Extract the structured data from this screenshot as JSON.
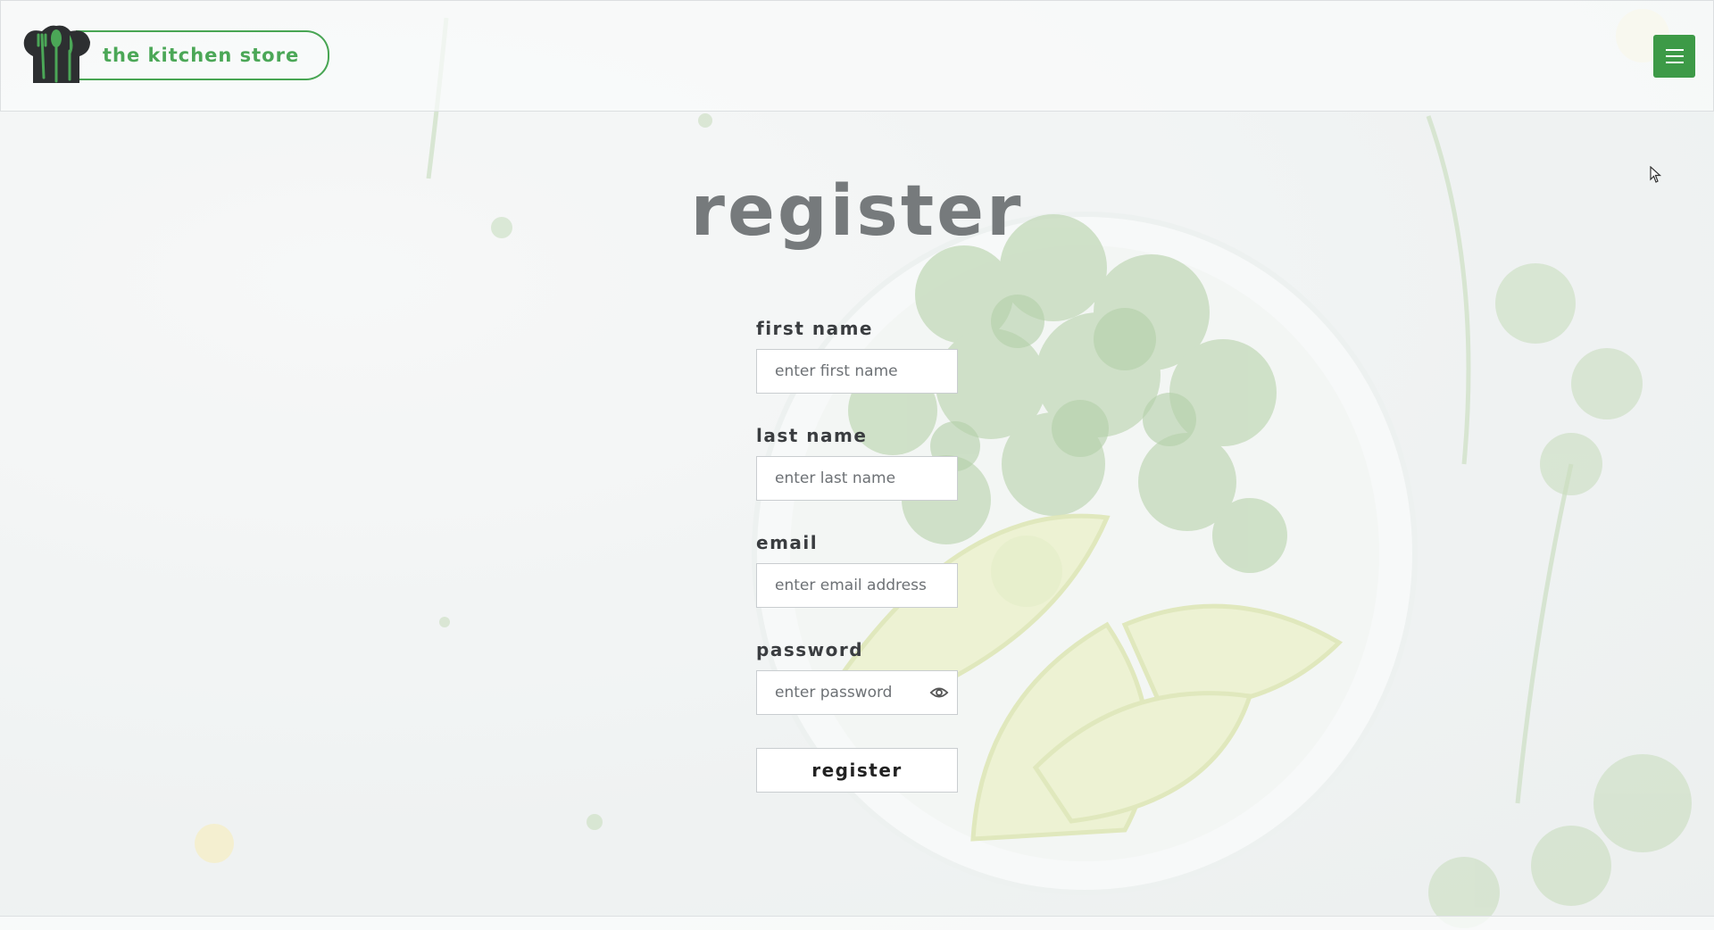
{
  "brand": {
    "name": "the kitchen store",
    "accent_color": "#48a553",
    "logo_icon": "chef-hat-utensils-icon"
  },
  "header": {
    "menu_icon": "hamburger-menu-icon"
  },
  "main": {
    "title": "register",
    "fields": [
      {
        "label": "first name",
        "placeholder": "enter first name",
        "value": ""
      },
      {
        "label": "last name",
        "placeholder": "enter last name",
        "value": ""
      },
      {
        "label": "email",
        "placeholder": "enter email address",
        "value": ""
      },
      {
        "label": "password",
        "placeholder": "enter password",
        "value": "",
        "toggle_icon": "eye-icon"
      }
    ],
    "submit_label": "register"
  },
  "background": {
    "subject": "bowl of cilantro and lime wedges",
    "colors": {
      "leaf": "#8fb87a",
      "lime": "#dbe6a0",
      "surface": "#eef1f1"
    }
  }
}
